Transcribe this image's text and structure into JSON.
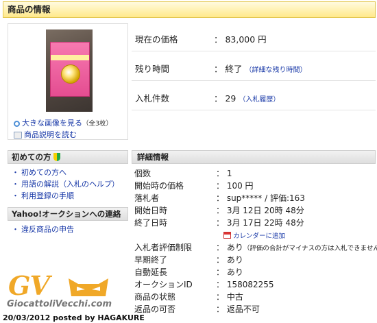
{
  "header": {
    "title": "商品の情報"
  },
  "image_panel": {
    "large_image_link": "大きな画像を見る",
    "large_image_count": "（全3枚）",
    "description_link": "商品説明を読む"
  },
  "side": {
    "beginners_title": "初めての方",
    "beginners_links": [
      "初めての方へ",
      "用語の解説（入札のヘルプ）",
      "利用登録の手順"
    ],
    "contact_title": "Yahoo!オークションへの連絡",
    "contact_links": [
      "違反商品の申告"
    ]
  },
  "summary": {
    "price_label": "現在の価格",
    "price_value": "： 83,000 円",
    "time_label": "残り時間",
    "time_value": "： 終了",
    "time_link": "（詳細な残り時間）",
    "bids_label": "入札件数",
    "bids_value": "： 29",
    "bids_link": "（入札履歴）"
  },
  "details": {
    "title": "詳細情報",
    "rows": [
      {
        "label": "個数",
        "value": "： 1"
      },
      {
        "label": "開始時の価格",
        "value": "： 100 円"
      },
      {
        "label": "落札者",
        "value": "： sup***** / 評価:163"
      },
      {
        "label": "開始日時",
        "value": "： 3月 12日 20時 48分"
      },
      {
        "label": "終了日時",
        "value": "： 3月 17日 22時 48分"
      },
      {
        "label": "入札者評価制限",
        "value": "： あり",
        "note": "（評価の合計がマイナスの方は入札できません）"
      },
      {
        "label": "早期終了",
        "value": "： あり"
      },
      {
        "label": "自動延長",
        "value": "： あり"
      },
      {
        "label": "オークションID",
        "value": "： 158082255"
      },
      {
        "label": "商品の状態",
        "value": "： 中古"
      },
      {
        "label": "返品の可否",
        "value": "： 返品不可"
      }
    ],
    "calendar_link": "カレンダーに追加"
  },
  "watermark": {
    "logo": "GV",
    "site": "GiocattoliVecchi.com",
    "posted": "20/03/2012 posted by HAGAKURE"
  },
  "colors": {
    "header_bg": "#ffe98a",
    "link": "#1a3aa8",
    "logo": "#f0a828"
  }
}
